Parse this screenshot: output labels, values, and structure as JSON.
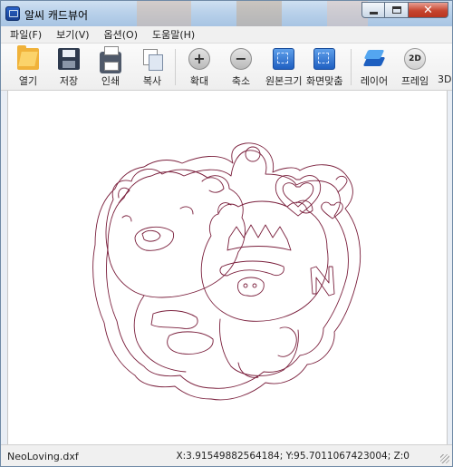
{
  "window": {
    "title": "알씨 캐드뷰어"
  },
  "menu": [
    "파일(F)",
    "보기(V)",
    "옵션(O)",
    "도움말(H)"
  ],
  "toolbar": {
    "open": "열기",
    "save": "저장",
    "print": "인쇄",
    "copy": "복사",
    "zoom_in": "확대",
    "zoom_out": "축소",
    "original_size": "원본크기",
    "fit_screen": "화면맞춤",
    "layer": "레이어",
    "frame": "프레임",
    "three_d": "3D",
    "frame_icon_text": "2D"
  },
  "drawing": {
    "letter": "N",
    "stroke_color": "#7a1f3c"
  },
  "status": {
    "filename": "NeoLoving.dxf",
    "coords": "X:3.91549882564184; Y:95.7011067423004; Z:0"
  }
}
